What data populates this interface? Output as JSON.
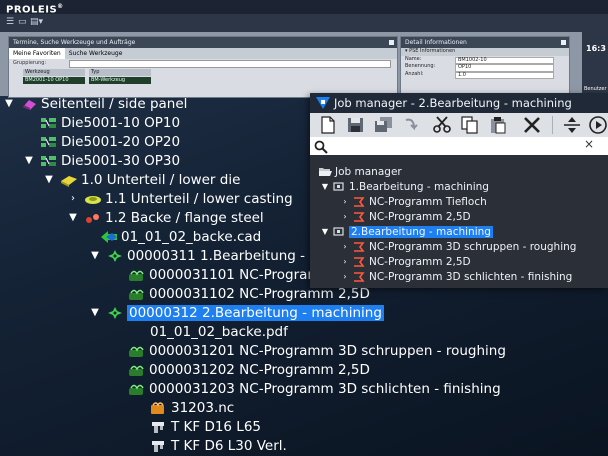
{
  "app": {
    "brand": "PROLEIS",
    "brand_mark": "®",
    "clock": "16:3",
    "left_panel": {
      "title": "Termine, Suche Werkzeuge und Aufträge",
      "tabs": [
        "Meine Favoriten",
        "Suche Werkzeuge"
      ],
      "group_label": "Gruppierung:",
      "columns": [
        "Werkzeug",
        "Typ"
      ],
      "row": [
        "BM2001-10 OP10",
        "BM-Werkzeug"
      ]
    },
    "detail_panel": {
      "title": "Detail Informationen",
      "section": "PSE Informationen",
      "fields": [
        {
          "label": "Name:",
          "value": "BM1002-10"
        },
        {
          "label": "Benennung:",
          "value": "OP10"
        },
        {
          "label": "Anzahl:",
          "value": "1.0"
        }
      ]
    },
    "user_label": "Benutzer"
  },
  "tree": [
    {
      "label": "Seitenteil / side panel"
    },
    {
      "label": "Die5001-10 OP10"
    },
    {
      "label": "Die5001-20 OP20"
    },
    {
      "label": "Die5001-30 OP30"
    },
    {
      "label": "1.0 Unterteil / lower die"
    },
    {
      "label": "1.1 Unterteil / lower casting"
    },
    {
      "label": "1.2 Backe / flange steel"
    },
    {
      "label": "01_01_02_backe.cad"
    },
    {
      "label": "00000311 1.Bearbeitung - "
    },
    {
      "label": "0000031101 NC-Program"
    },
    {
      "label": "0000031102 NC-Programm 2,5D"
    },
    {
      "label": "00000312 2.Bearbeitung - machining"
    },
    {
      "label": "01_01_02_backe.pdf"
    },
    {
      "label": "0000031201 NC-Programm 3D schruppen - roughing"
    },
    {
      "label": "0000031202 NC-Programm 2,5D"
    },
    {
      "label": "0000031203 NC-Programm 3D schlichten - finishing"
    },
    {
      "label": "31203.nc"
    },
    {
      "label": "T KF D16 L65"
    },
    {
      "label": "T KF D6 L30 Verl."
    }
  ],
  "job_manager": {
    "title": "Job manager - 2.Bearbeitung - machining",
    "search_placeholder": "",
    "clear_symbol": "×",
    "tree": [
      {
        "label": "Job manager"
      },
      {
        "label": "1.Bearbeitung - machining"
      },
      {
        "label": "NC-Programm Tiefloch"
      },
      {
        "label": "NC-Programm 2,5D"
      },
      {
        "label": "2.Bearbeitung - machining"
      },
      {
        "label": "NC-Programm 3D schruppen - roughing"
      },
      {
        "label": "NC-Programm 2,5D"
      },
      {
        "label": "NC-Programm 3D schlichten - finishing"
      }
    ]
  },
  "colors": {
    "selection": "#1e7ff0",
    "background": "#142235"
  }
}
